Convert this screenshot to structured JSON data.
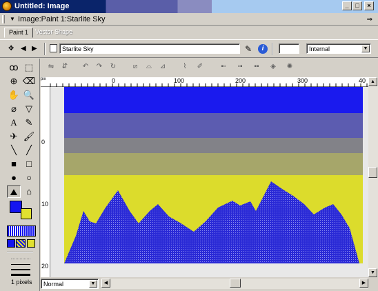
{
  "window": {
    "title": "Untitled: Image",
    "buttons": {
      "minimize": "_",
      "maximize": "□",
      "close": "×"
    }
  },
  "document": {
    "title": "Image:Paint 1:Starlite Sky",
    "menu_icon": "⇒"
  },
  "tabs": [
    {
      "label": "Paint 1",
      "active": true
    },
    {
      "label": "Vector Shape",
      "active": false
    }
  ],
  "properties": {
    "object_name": "Starlite Sky",
    "number_field": "",
    "scope": "Internal"
  },
  "rulers": {
    "horizontal": [
      "0",
      "100",
      "200",
      "300",
      "40"
    ],
    "vertical": [
      "0",
      "10",
      "20"
    ],
    "corner": "pix"
  },
  "tools": {
    "brush_size": "1 pixels",
    "stroke_color": "#1414f0",
    "fill_color": "#e0e030"
  },
  "canvas": {
    "bands": [
      {
        "color": "#1a1aee"
      },
      {
        "color": "#5c5cb0"
      },
      {
        "color": "#828288"
      },
      {
        "color": "#a6a66a"
      },
      {
        "color": "#dcdc2c"
      }
    ],
    "mountain_color": "#2a2ad6"
  },
  "bottom": {
    "ink_mode": "Normal"
  }
}
